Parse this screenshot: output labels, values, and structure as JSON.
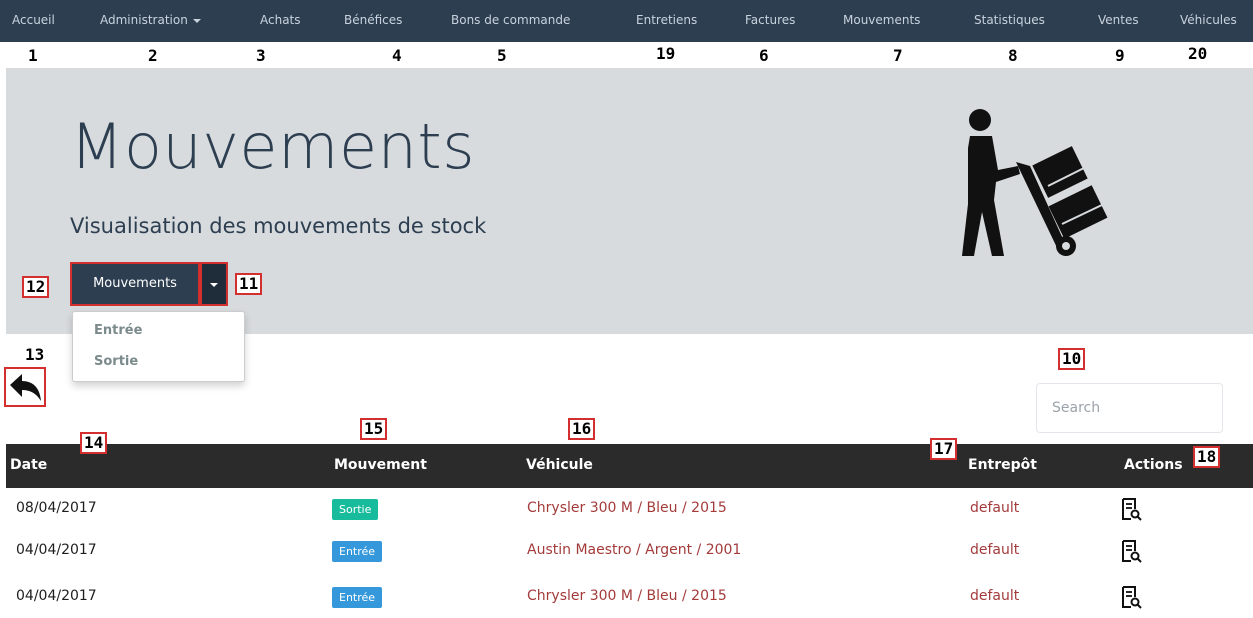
{
  "nav": {
    "items": [
      {
        "label": "Accueil"
      },
      {
        "label": "Administration"
      },
      {
        "label": "Achats"
      },
      {
        "label": "Bénéfices"
      },
      {
        "label": "Bons de commande"
      },
      {
        "label": "Entretiens"
      },
      {
        "label": "Factures"
      },
      {
        "label": "Mouvements"
      },
      {
        "label": "Statistiques"
      },
      {
        "label": "Ventes"
      },
      {
        "label": "Véhicules"
      }
    ]
  },
  "annotations": [
    "1",
    "2",
    "3",
    "4",
    "5",
    "19",
    "6",
    "7",
    "8",
    "9",
    "20",
    "12",
    "11",
    "13",
    "10",
    "14",
    "15",
    "16",
    "17",
    "18"
  ],
  "header": {
    "title": "Mouvements",
    "subtitle": "Visualisation des mouvements de stock",
    "icon": "hand-truck-mover-icon"
  },
  "filter": {
    "button_label": "Mouvements",
    "options": [
      "Entrée",
      "Sortie"
    ]
  },
  "search": {
    "placeholder": "Search"
  },
  "table": {
    "headers": {
      "date": "Date",
      "mouvement": "Mouvement",
      "vehicule": "Véhicule",
      "entrepot": "Entrepôt",
      "actions": "Actions"
    },
    "rows": [
      {
        "date": "08/04/2017",
        "mouvement": "Sortie",
        "vehicule": "Chrysler 300 M / Bleu / 2015",
        "entrepot": "default"
      },
      {
        "date": "04/04/2017",
        "mouvement": "Entrée",
        "vehicule": "Austin Maestro / Argent / 2001",
        "entrepot": "default"
      },
      {
        "date": "04/04/2017",
        "mouvement": "Entrée",
        "vehicule": "Chrysler 300 M / Bleu / 2015",
        "entrepot": "default"
      }
    ]
  },
  "colors": {
    "navbar": "#2c3e50",
    "jumbotron": "#d8dbde",
    "badge_sortie": "#18bc9c",
    "badge_entree": "#3498db",
    "link": "#a33b3b",
    "annotation_box": "#d32f2f"
  }
}
